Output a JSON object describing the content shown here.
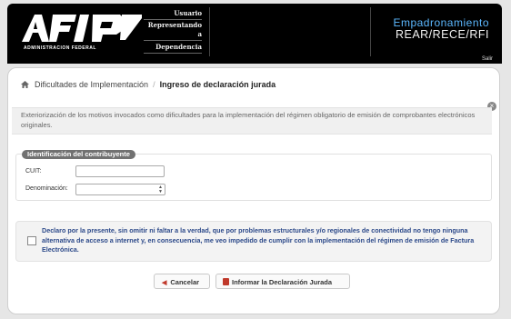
{
  "header": {
    "logo_sub": "ADMINISTRACION FEDERAL",
    "usuario_label": "Usuario",
    "representando_label": "Representando a",
    "dependencia_label": "Dependencia",
    "app_line1": "Empadronamiento",
    "app_line2": "REAR/RECE/RFI",
    "salir": "Salir"
  },
  "breadcrumb": {
    "item1": "Dificultades de Implementación",
    "separator": "/",
    "item2": "Ingreso de declaración jurada"
  },
  "close_glyph": "×",
  "description": "Exteriorización de los motivos invocados como dificultades para la implementación del régimen obligatorio de emisión de comprobantes electrónicos originales.",
  "form": {
    "legend": "Identificación del contribuyente",
    "cuit_label": "CUIT:",
    "cuit_value": "",
    "denominacion_label": "Denominación:",
    "denominacion_value": ""
  },
  "declaration": {
    "checked": false,
    "text": "Declaro por la presente, sin omitir ni faltar a la verdad, que por problemas estructurales y/o regionales de conectividad no tengo ninguna alternativa de acceso a internet y, en consecuencia, me veo impedido de cumplir con la implementación del régimen de emisión de Factura Electrónica."
  },
  "buttons": {
    "cancel": "Cancelar",
    "inform": "Informar la Declaración Jurada"
  },
  "colors": {
    "header_bg": "#000000",
    "accent_blue": "#5cb8ff",
    "declaration_text": "#2d4a8a",
    "button_icon_red": "#c0392b"
  }
}
